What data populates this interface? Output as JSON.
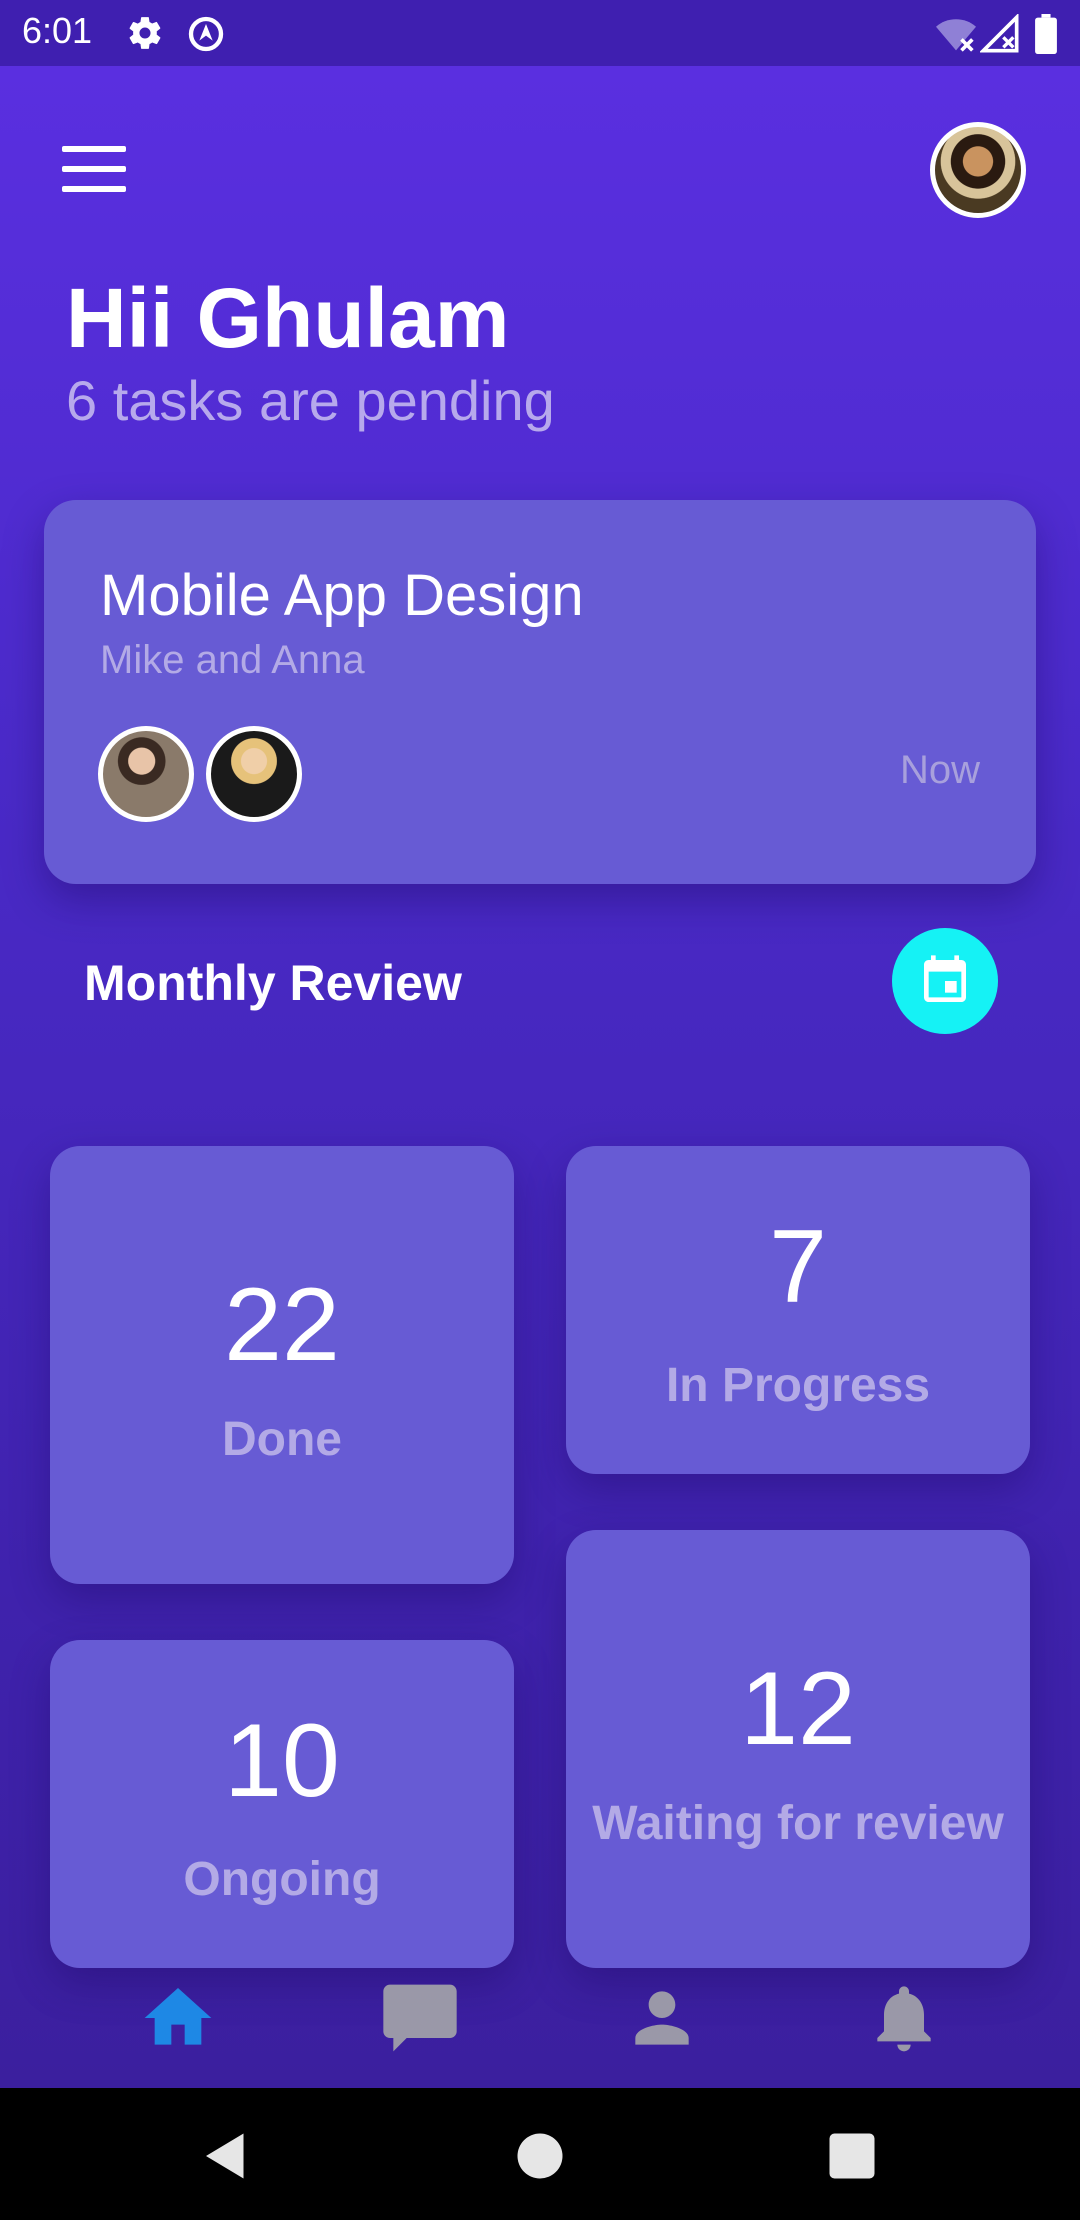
{
  "status_bar": {
    "time": "6:01",
    "icons": [
      "gear-icon",
      "location-icon",
      "wifi-off-icon",
      "signal-icon",
      "battery-icon"
    ]
  },
  "header": {
    "greeting": "Hii Ghulam",
    "pending_text": "6 tasks are pending"
  },
  "project_card": {
    "title": "Mobile App Design",
    "members": "Mike and Anna",
    "time": "Now"
  },
  "monthly_review": {
    "title": "Monthly Review",
    "stats": [
      {
        "value": "22",
        "label": "Done"
      },
      {
        "value": "7",
        "label": "In Progress"
      },
      {
        "value": "10",
        "label": "Ongoing"
      },
      {
        "value": "12",
        "label": "Waiting for review"
      }
    ]
  },
  "bottom_nav": {
    "items": [
      "home-icon",
      "chat-icon",
      "person-icon",
      "bell-icon"
    ],
    "active": "home-icon"
  },
  "colors": {
    "background": "#4a2ac8",
    "card": "#675bd4",
    "accent": "#15f2f5",
    "active_nav": "#1e88e5",
    "muted_text": "#b3aae6"
  }
}
